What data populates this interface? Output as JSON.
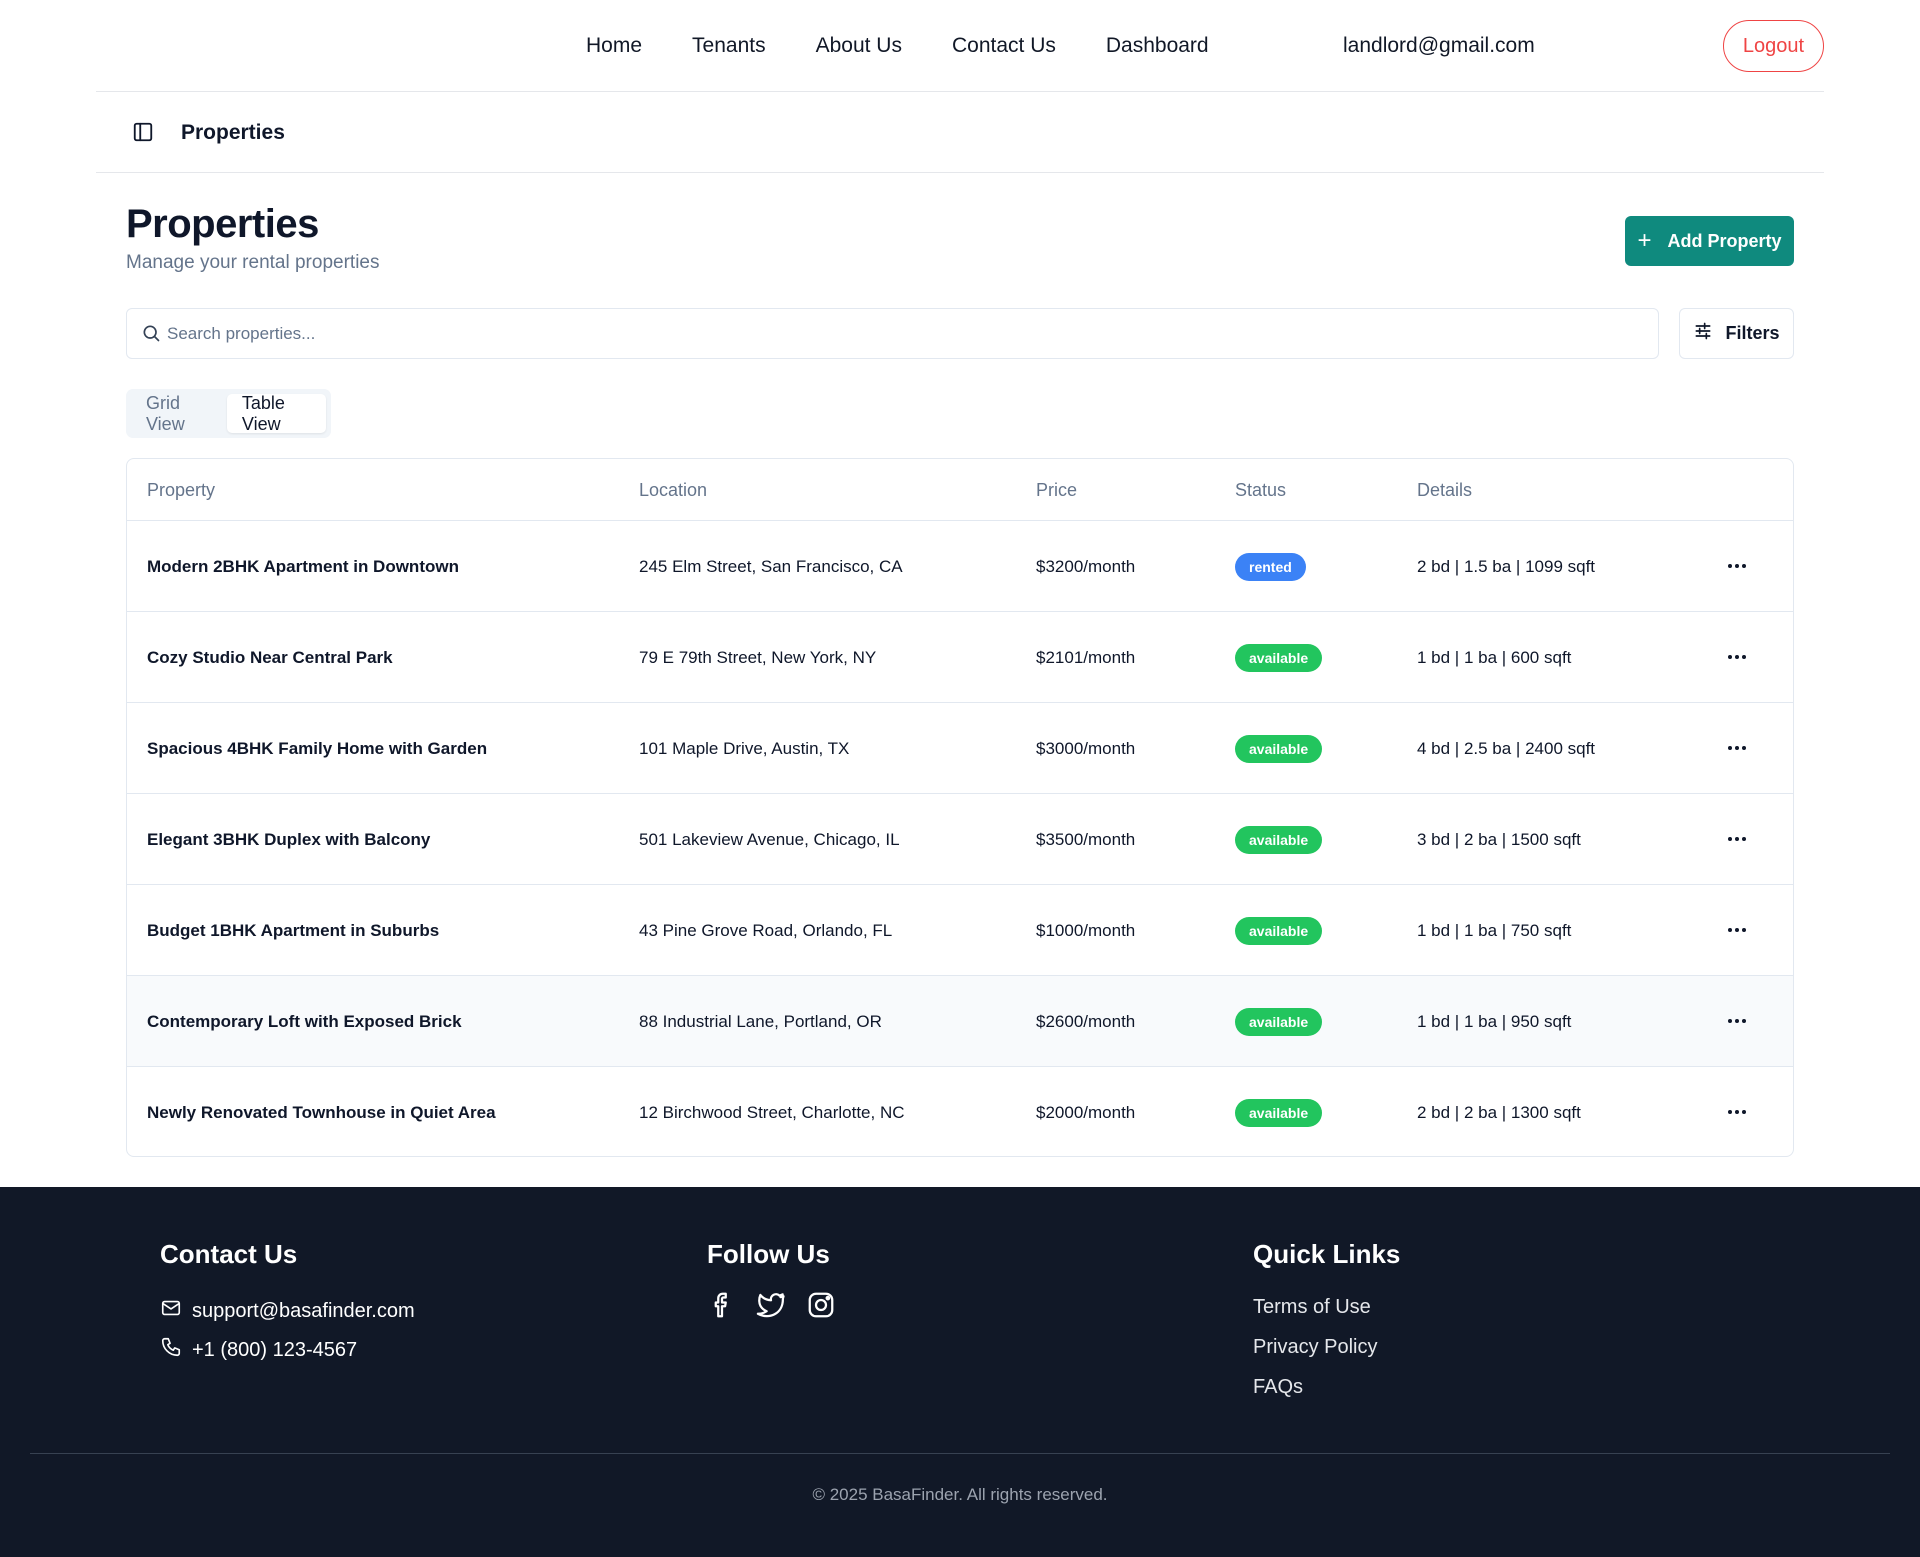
{
  "nav": {
    "links": [
      "Home",
      "Tenants",
      "About Us",
      "Contact Us",
      "Dashboard"
    ],
    "email": "landlord@gmail.com",
    "logout": "Logout"
  },
  "breadcrumb": {
    "title": "Properties"
  },
  "page": {
    "title": "Properties",
    "subtitle": "Manage your rental properties",
    "add_button": "Add Property"
  },
  "search": {
    "placeholder": "Search properties...",
    "filters_label": "Filters"
  },
  "view_toggle": {
    "grid": "Grid View",
    "table": "Table View",
    "active": "Table View"
  },
  "table": {
    "headers": [
      "Property",
      "Location",
      "Price",
      "Status",
      "Details"
    ],
    "rows": [
      {
        "name": "Modern 2BHK Apartment in Downtown",
        "location": "245 Elm Street, San Francisco, CA",
        "price": "$3200/month",
        "status": "rented",
        "details": "2 bd | 1.5 ba | 1099 sqft"
      },
      {
        "name": "Cozy Studio Near Central Park",
        "location": "79 E 79th Street, New York, NY",
        "price": "$2101/month",
        "status": "available",
        "details": "1 bd | 1 ba | 600 sqft"
      },
      {
        "name": "Spacious 4BHK Family Home with Garden",
        "location": "101 Maple Drive, Austin, TX",
        "price": "$3000/month",
        "status": "available",
        "details": "4 bd | 2.5 ba | 2400 sqft"
      },
      {
        "name": "Elegant 3BHK Duplex with Balcony",
        "location": "501 Lakeview Avenue, Chicago, IL",
        "price": "$3500/month",
        "status": "available",
        "details": "3 bd | 2 ba | 1500 sqft"
      },
      {
        "name": "Budget 1BHK Apartment in Suburbs",
        "location": "43 Pine Grove Road, Orlando, FL",
        "price": "$1000/month",
        "status": "available",
        "details": "1 bd | 1 ba | 750 sqft"
      },
      {
        "name": "Contemporary Loft with Exposed Brick",
        "location": "88 Industrial Lane, Portland, OR",
        "price": "$2600/month",
        "status": "available",
        "details": "1 bd | 1 ba | 950 sqft"
      },
      {
        "name": "Newly Renovated Townhouse in Quiet Area",
        "location": "12 Birchwood Street, Charlotte, NC",
        "price": "$2000/month",
        "status": "available",
        "details": "2 bd | 2 ba | 1300 sqft"
      }
    ]
  },
  "footer": {
    "contact_title": "Contact Us",
    "email": "support@basafinder.com",
    "phone": "+1 (800) 123-4567",
    "follow_title": "Follow Us",
    "socials": [
      "facebook-icon",
      "twitter-icon",
      "instagram-icon"
    ],
    "quick_title": "Quick Links",
    "quick_links": [
      "Terms of Use",
      "Privacy Policy",
      "FAQs"
    ],
    "copyright": "© 2025 BasaFinder. All rights reserved."
  },
  "colors": {
    "accent": "#0f8a7e",
    "logout": "#ef4444",
    "rented": "#3b82f6",
    "available": "#22c55e",
    "footer_bg": "#111827"
  }
}
